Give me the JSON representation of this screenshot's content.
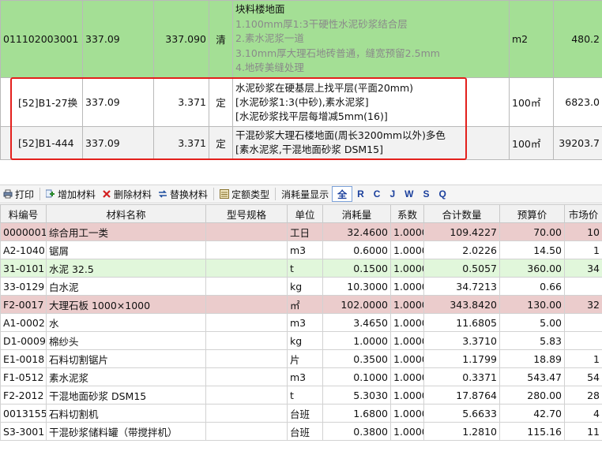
{
  "quota_rows": [
    {
      "code": "011102003001",
      "qty": "337.09",
      "qty2": "337.090",
      "type": "清",
      "desc_title": "块料楼地面",
      "desc_lines": [
        "1.100mm厚1:3干硬性水泥砂浆结合层",
        "2.素水泥浆一道",
        "3.10mm厚大理石地砖普通，缝宽预留2.5mm",
        "4.地砖美缝处理"
      ],
      "unit": "m2",
      "amount": "480.2"
    },
    {
      "code": "[52]B1-27换",
      "qty": "337.09",
      "qty2": "3.371",
      "type": "定",
      "desc_lines": [
        "水泥砂浆在硬基层上找平层(平面20mm)",
        "[水泥砂浆1:3(中砂),素水泥浆]",
        "[水泥砂浆找平层每增减5mm(16)]"
      ],
      "unit": "100㎡",
      "amount": "6823.0"
    },
    {
      "code": "[52]B1-444",
      "qty": "337.09",
      "qty2": "3.371",
      "type": "定",
      "desc_lines": [
        "干混砂浆大理石楼地面(周长3200mm以外)多色",
        "[素水泥浆,干混地面砂浆 DSM15]"
      ],
      "unit": "100㎡",
      "amount": "39203.7"
    }
  ],
  "toolbar": {
    "print": "打印",
    "add": "增加材料",
    "delete": "删除材料",
    "replace": "替换材料",
    "quota_type": "定额类型",
    "consumption": "消耗量显示",
    "filters": [
      "全",
      "R",
      "C",
      "J",
      "W",
      "S",
      "Q"
    ],
    "active_filter": "全"
  },
  "materials": {
    "headers": [
      "料编号",
      "材料名称",
      "型号规格",
      "单位",
      "消耗量",
      "系数",
      "合计数量",
      "预算价",
      "市场价"
    ],
    "rows": [
      {
        "code": "0000001",
        "name": "综合用工一类",
        "spec": "",
        "unit": "工日",
        "consumption": "32.4600",
        "coef": "1.00000",
        "total": "109.4227",
        "price": "70.00",
        "market": "10",
        "style": "pink"
      },
      {
        "code": "A2-1040",
        "name": "锯屑",
        "spec": "",
        "unit": "m3",
        "consumption": "0.6000",
        "coef": "1.00000",
        "total": "2.0226",
        "price": "14.50",
        "market": "1",
        "style": "plain"
      },
      {
        "code": "31-0101",
        "name": "水泥 32.5",
        "spec": "",
        "unit": "t",
        "consumption": "0.1500",
        "coef": "1.00000",
        "total": "0.5057",
        "price": "360.00",
        "market": "34",
        "style": "lgreen"
      },
      {
        "code": "33-0129",
        "name": "白水泥",
        "spec": "",
        "unit": "kg",
        "consumption": "10.3000",
        "coef": "1.00000",
        "total": "34.7213",
        "price": "0.66",
        "market": "",
        "style": "plain"
      },
      {
        "code": "F2-0017",
        "name": "大理石板 1000×1000",
        "spec": "",
        "unit": "㎡",
        "consumption": "102.0000",
        "coef": "1.00000",
        "total": "343.8420",
        "price": "130.00",
        "market": "32",
        "style": "pink"
      },
      {
        "code": "A1-0002",
        "name": "水",
        "spec": "",
        "unit": "m3",
        "consumption": "3.4650",
        "coef": "1.00000",
        "total": "11.6805",
        "price": "5.00",
        "market": "",
        "style": "plain"
      },
      {
        "code": "D1-0009",
        "name": "棉纱头",
        "spec": "",
        "unit": "kg",
        "consumption": "1.0000",
        "coef": "1.00000",
        "total": "3.3710",
        "price": "5.83",
        "market": "",
        "style": "plain"
      },
      {
        "code": "E1-0018",
        "name": "石料切割锯片",
        "spec": "",
        "unit": "片",
        "consumption": "0.3500",
        "coef": "1.00000",
        "total": "1.1799",
        "price": "18.89",
        "market": "1",
        "style": "plain"
      },
      {
        "code": "F1-0512",
        "name": "素水泥浆",
        "spec": "",
        "unit": "m3",
        "consumption": "0.1000",
        "coef": "1.00000",
        "total": "0.3371",
        "price": "543.47",
        "market": "54",
        "style": "plain"
      },
      {
        "code": "F2-2012",
        "name": "干混地面砂浆 DSM15",
        "spec": "",
        "unit": "t",
        "consumption": "5.3030",
        "coef": "1.00000",
        "total": "17.8764",
        "price": "280.00",
        "market": "28",
        "style": "plain"
      },
      {
        "code": "0013155",
        "name": "石料切割机",
        "spec": "",
        "unit": "台班",
        "consumption": "1.6800",
        "coef": "1.00000",
        "total": "5.6633",
        "price": "42.70",
        "market": "4",
        "style": "plain"
      },
      {
        "code": "S3-3001",
        "name": "干混砂浆储料罐（带搅拌机）",
        "spec": "",
        "unit": "台班",
        "consumption": "0.3800",
        "coef": "1.00000",
        "total": "1.2810",
        "price": "115.16",
        "market": "11",
        "style": "plain"
      }
    ]
  },
  "colors": {
    "green_row": "#a4df95",
    "pink_row": "#ebcccc",
    "light_green_row": "#e1f7db",
    "highlight_box": "#e3201c",
    "filter_text": "#1a3f9c"
  }
}
